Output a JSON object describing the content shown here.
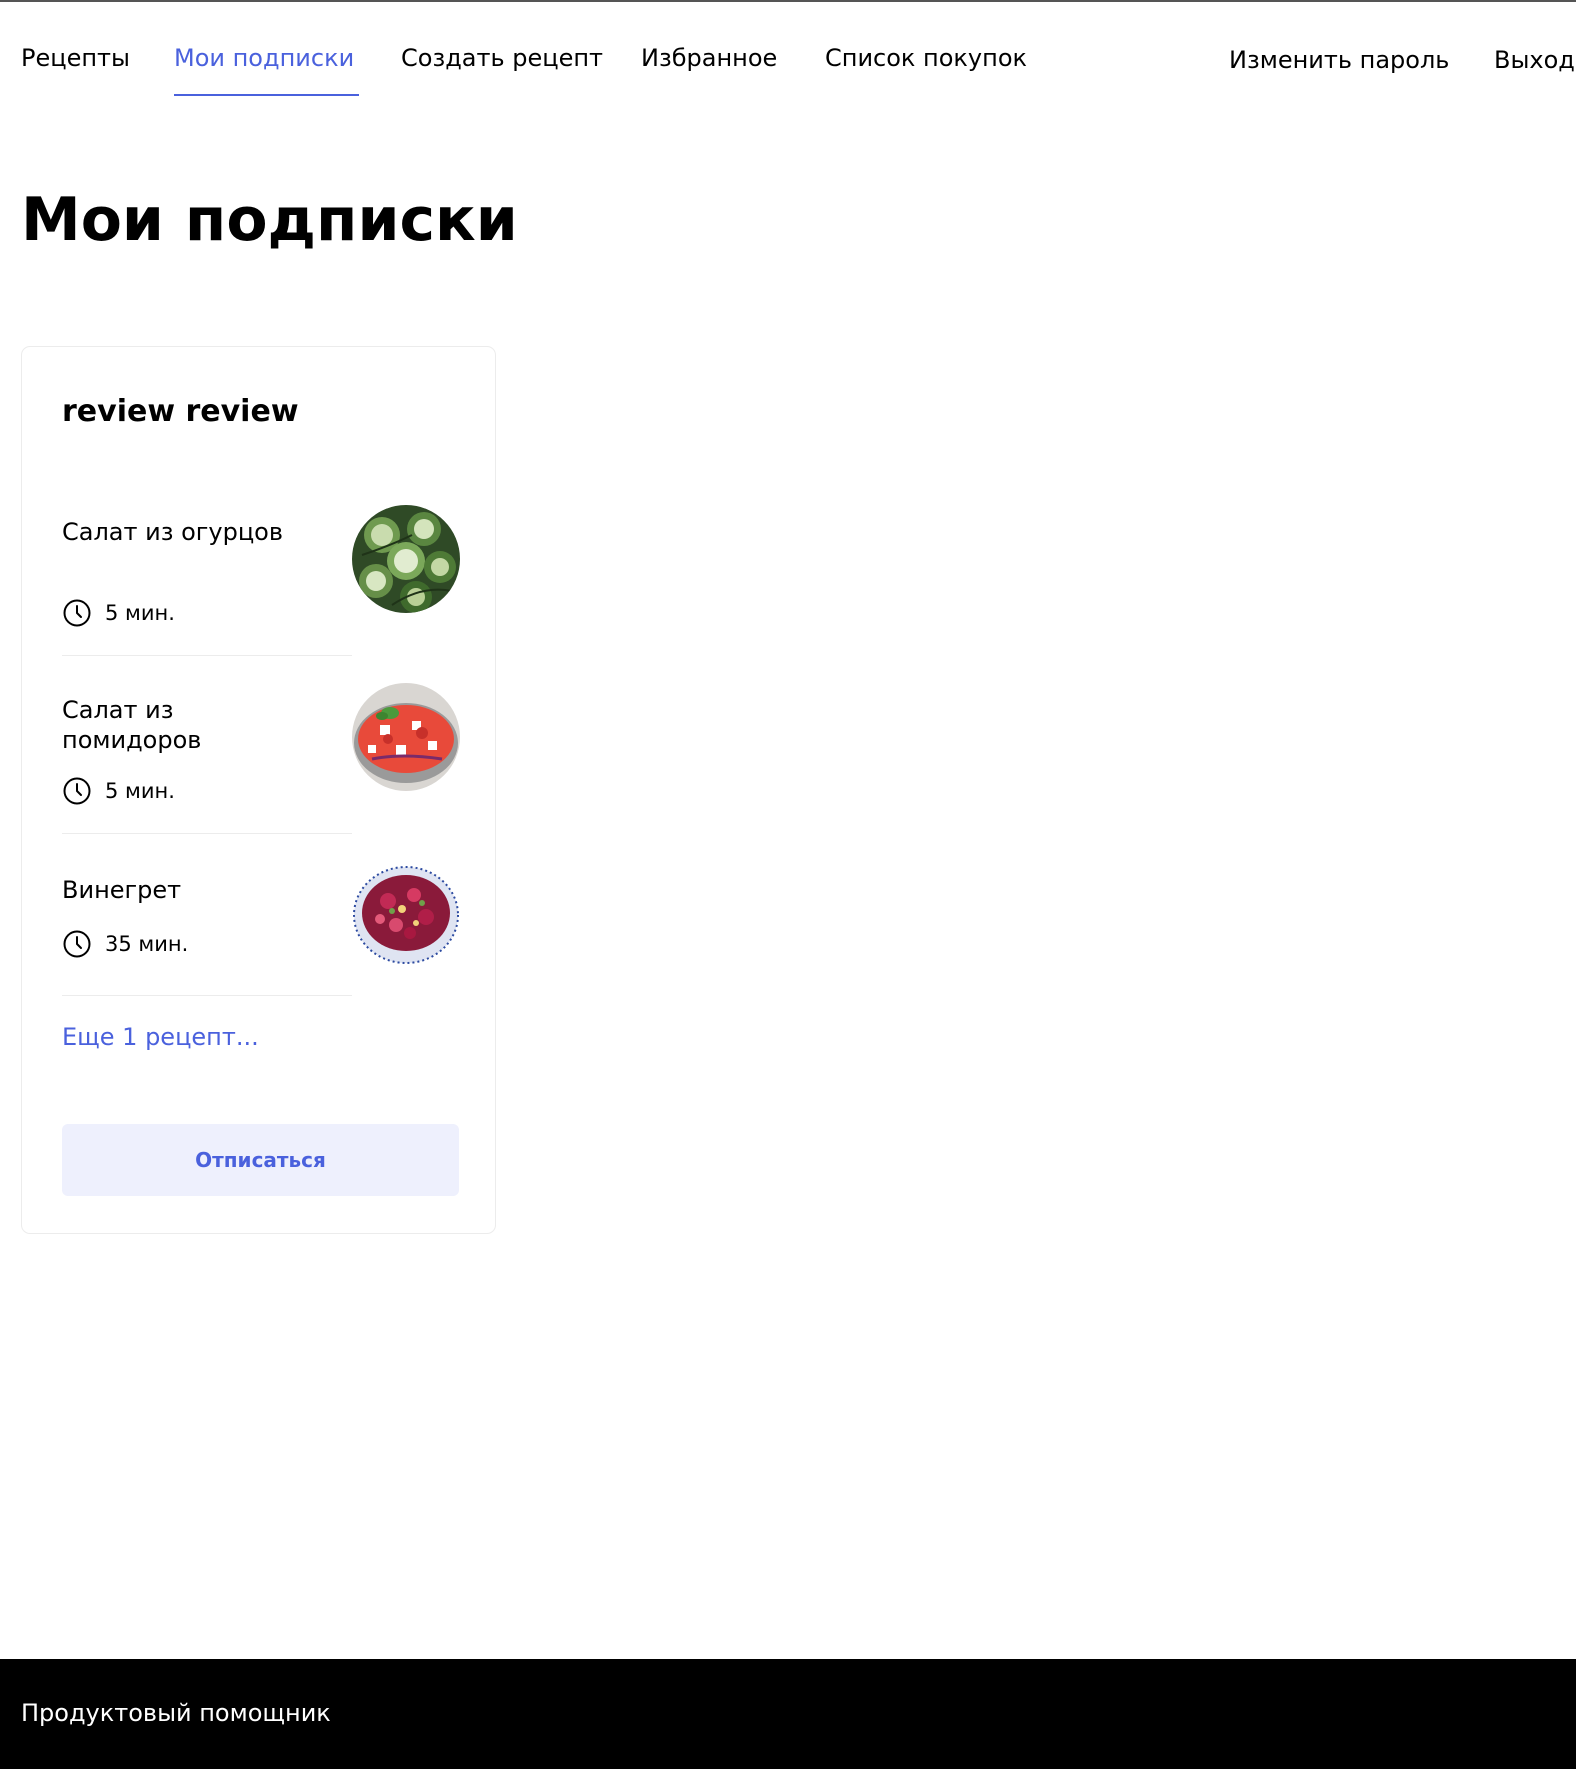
{
  "header": {
    "nav": [
      {
        "label": "Рецепты",
        "active": false
      },
      {
        "label": "Мои подписки",
        "active": true
      },
      {
        "label": "Создать рецепт",
        "active": false
      },
      {
        "label": "Избранное",
        "active": false
      },
      {
        "label": "Список покупок",
        "active": false
      }
    ],
    "change_password_label": "Изменить пароль",
    "logout_label": "Выход"
  },
  "main": {
    "title": "Мои подписки",
    "subscriptions": [
      {
        "author": "review review",
        "recipes": [
          {
            "name": "Салат из огурцов",
            "time": "5 мин.",
            "image": "cucumber-salad-photo"
          },
          {
            "name": "Салат из помидоров",
            "time": "5 мин.",
            "image": "tomato-salad-photo"
          },
          {
            "name": "Винегрет",
            "time": "35 мин.",
            "image": "vinegret-photo"
          }
        ],
        "more_label": "Еще 1 рецепт...",
        "unsubscribe_label": "Отписаться"
      }
    ]
  },
  "footer": {
    "text": "Продуктовый помощник"
  },
  "colors": {
    "accent": "#4a61dd",
    "button_bg": "#eef0fd",
    "footer_bg": "#000000",
    "card_border": "#ececec"
  },
  "icons": {
    "time": "clock-icon"
  }
}
